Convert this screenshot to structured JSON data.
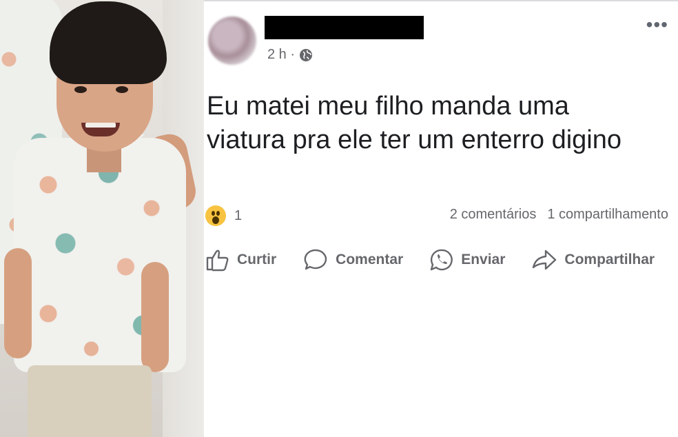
{
  "post": {
    "timestamp": "2 h ·",
    "more_label": "•••",
    "text": "Eu matei meu filho manda uma viatura pra ele ter um enterro digino",
    "reaction_count": "1",
    "comments": "2 comentários",
    "shares": "1 compartilhamento"
  },
  "actions": {
    "like": "Curtir",
    "comment": "Comentar",
    "send": "Enviar",
    "share": "Compartilhar"
  },
  "icons": {
    "privacy": "globe-icon",
    "reaction": "wow-icon",
    "like": "thumbs-up-icon",
    "comment": "comment-bubble-icon",
    "send": "whatsapp-icon",
    "share": "share-arrow-icon"
  },
  "colors": {
    "text": "#1c1e21",
    "secondary": "#65676b",
    "wow": "#f7c340"
  }
}
